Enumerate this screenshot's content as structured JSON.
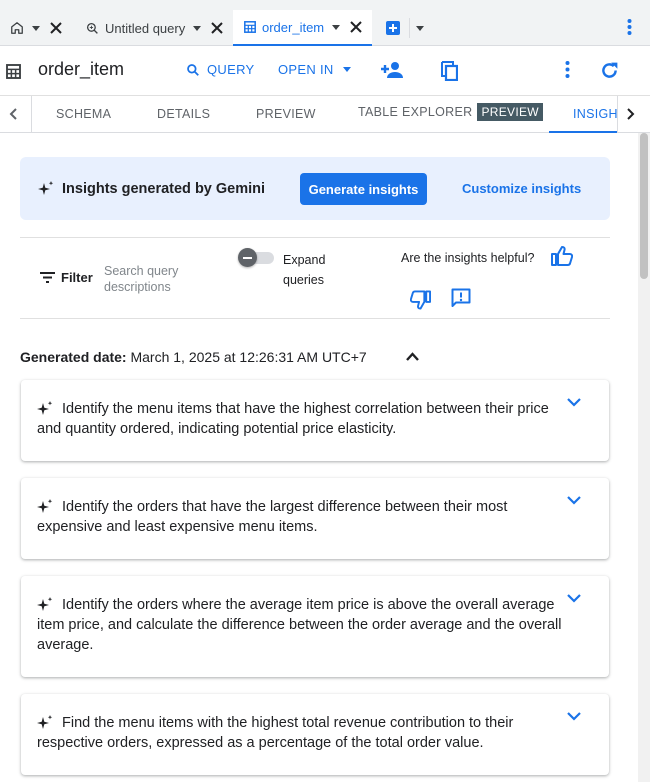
{
  "tabs": [
    {
      "label": "",
      "icon": "home-icon"
    },
    {
      "label": "Untitled query",
      "icon": "query-icon"
    },
    {
      "label": "order_item",
      "icon": "table-icon",
      "active": true
    }
  ],
  "toolbar": {
    "title": "order_item",
    "query_label": "QUERY",
    "open_in_label": "OPEN IN"
  },
  "subtabs": {
    "schema": "SCHEMA",
    "details": "DETAILS",
    "preview": "PREVIEW",
    "table_explorer": "TABLE EXPLORER",
    "preview_chip": "PREVIEW",
    "insights": "INSIGHTS"
  },
  "banner": {
    "title": "Insights generated by Gemini",
    "generate_label": "Generate insights",
    "customize_label": "Customize insights"
  },
  "filter": {
    "label": "Filter",
    "search_placeholder": "Search query descriptions",
    "expand_label": "Expand queries",
    "helpful_label": "Are the insights helpful?"
  },
  "generated": {
    "label": "Generated date:",
    "value": "March 1, 2025 at 12:26:31 AM UTC+7"
  },
  "insights": [
    {
      "text": "Identify the menu items that have the highest correlation between their price and quantity ordered, indicating potential price elasticity."
    },
    {
      "text": "Identify the orders that have the largest difference between their most expensive and least expensive menu items."
    },
    {
      "text": "Identify the orders where the average item price is above the overall average item price, and calculate the difference between the order average and the overall average."
    },
    {
      "text": "Find the menu items with the highest total revenue contribution to their respective orders, expressed as a percentage of the total order value."
    }
  ],
  "colors": {
    "accent": "#1a73e8",
    "banner_bg": "#e8f0fe",
    "preview_chip": "#455a64"
  }
}
